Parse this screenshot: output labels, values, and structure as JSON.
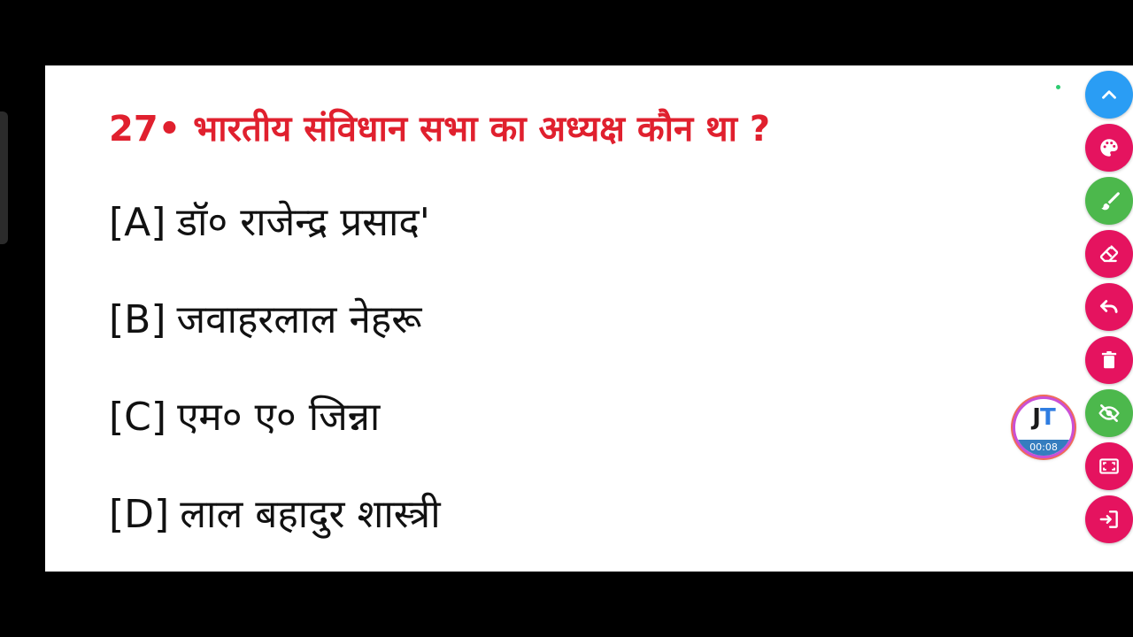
{
  "question": {
    "number": "27•",
    "text": "भारतीय संविधान सभा का अध्यक्ष कौन था ?"
  },
  "options": [
    {
      "letter": "[A]",
      "text": "डॉ० राजेन्द्र प्रसाद'"
    },
    {
      "letter": "[B]",
      "text": "जवाहरलाल नेहरू"
    },
    {
      "letter": "[C]",
      "text": "एम० ए० जिन्ना"
    },
    {
      "letter": "[D]",
      "text": "लाल बहादुर शास्त्री"
    }
  ],
  "colors": {
    "question": "#e0202e",
    "option_text": "#111111",
    "tool_blue": "#2a9df4",
    "tool_pink": "#e5135f",
    "tool_green": "#4cb84c"
  },
  "toolbar": [
    {
      "icon": "chevron-up-icon",
      "color": "#2a9df4"
    },
    {
      "icon": "palette-icon",
      "color": "#e5135f"
    },
    {
      "icon": "brush-icon",
      "color": "#4cb84c"
    },
    {
      "icon": "eraser-icon",
      "color": "#e5135f"
    },
    {
      "icon": "undo-icon",
      "color": "#e5135f"
    },
    {
      "icon": "trash-icon",
      "color": "#e5135f"
    },
    {
      "icon": "eye-off-icon",
      "color": "#4cb84c"
    },
    {
      "icon": "fullscreen-icon",
      "color": "#e5135f"
    },
    {
      "icon": "exit-icon",
      "color": "#e5135f"
    }
  ],
  "recorder": {
    "logo_j": "J",
    "logo_t": "T",
    "timer": "00:08"
  }
}
